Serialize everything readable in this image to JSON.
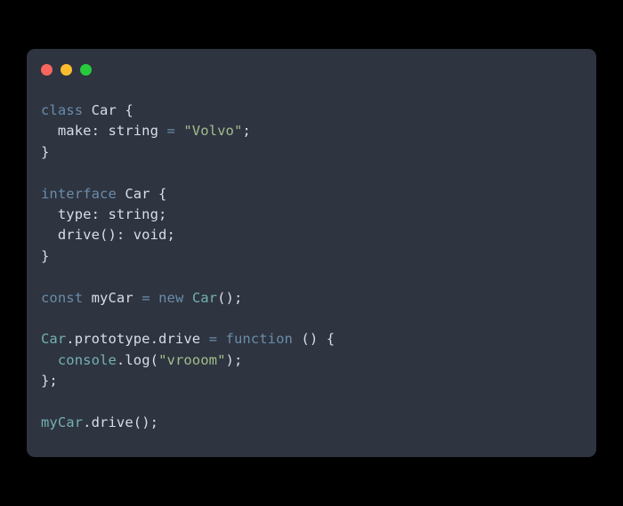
{
  "window": {
    "title": "code-snippet-card",
    "background_color": "#000000",
    "card_color": "#2e3440",
    "traffic_lights": [
      {
        "name": "close",
        "color": "#f9665e"
      },
      {
        "name": "minimize",
        "color": "#fbbd2e"
      },
      {
        "name": "maximize",
        "color": "#28c93f"
      }
    ]
  },
  "theme": {
    "keyword_color": "#6a8caa",
    "plain_color": "#d8dee9",
    "string_color": "#a3be8c",
    "type_color": "#74b1b2",
    "operator_color": "#6a8caa"
  },
  "code": {
    "language": "typescript",
    "plain_text": "class Car {\n  make: string = \"Volvo\";\n}\n\ninterface Car {\n  type: string;\n  drive(): void;\n}\n\nconst myCar = new Car();\n\nCar.prototype.drive = function () {\n  console.log(\"vrooom\");\n};\n\nmyCar.drive();",
    "lines": [
      {
        "n": 1,
        "tokens": [
          {
            "t": "class",
            "k": "keyword"
          },
          {
            "t": " Car {",
            "k": "plain"
          }
        ]
      },
      {
        "n": 2,
        "tokens": [
          {
            "t": "  make: string ",
            "k": "plain"
          },
          {
            "t": "=",
            "k": "operator"
          },
          {
            "t": " ",
            "k": "plain"
          },
          {
            "t": "\"Volvo\"",
            "k": "string"
          },
          {
            "t": ";",
            "k": "plain"
          }
        ]
      },
      {
        "n": 3,
        "tokens": [
          {
            "t": "}",
            "k": "plain"
          }
        ]
      },
      {
        "n": 4,
        "tokens": [
          {
            "t": " ",
            "k": "blank"
          }
        ]
      },
      {
        "n": 5,
        "tokens": [
          {
            "t": "interface",
            "k": "keyword"
          },
          {
            "t": " Car {",
            "k": "plain"
          }
        ]
      },
      {
        "n": 6,
        "tokens": [
          {
            "t": "  type: string;",
            "k": "plain"
          }
        ]
      },
      {
        "n": 7,
        "tokens": [
          {
            "t": "  drive(): void;",
            "k": "plain"
          }
        ]
      },
      {
        "n": 8,
        "tokens": [
          {
            "t": "}",
            "k": "plain"
          }
        ]
      },
      {
        "n": 9,
        "tokens": [
          {
            "t": " ",
            "k": "blank"
          }
        ]
      },
      {
        "n": 10,
        "tokens": [
          {
            "t": "const",
            "k": "keyword"
          },
          {
            "t": " myCar ",
            "k": "plain"
          },
          {
            "t": "=",
            "k": "operator"
          },
          {
            "t": " ",
            "k": "plain"
          },
          {
            "t": "new",
            "k": "keyword"
          },
          {
            "t": " ",
            "k": "plain"
          },
          {
            "t": "Car",
            "k": "type"
          },
          {
            "t": "();",
            "k": "plain"
          }
        ]
      },
      {
        "n": 11,
        "tokens": [
          {
            "t": " ",
            "k": "blank"
          }
        ]
      },
      {
        "n": 12,
        "tokens": [
          {
            "t": "Car",
            "k": "type"
          },
          {
            "t": ".prototype.drive ",
            "k": "plain"
          },
          {
            "t": "=",
            "k": "operator"
          },
          {
            "t": " ",
            "k": "plain"
          },
          {
            "t": "function",
            "k": "keyword"
          },
          {
            "t": " () {",
            "k": "plain"
          }
        ]
      },
      {
        "n": 13,
        "tokens": [
          {
            "t": "  ",
            "k": "plain"
          },
          {
            "t": "console",
            "k": "type"
          },
          {
            "t": ".log(",
            "k": "plain"
          },
          {
            "t": "\"vrooom\"",
            "k": "string"
          },
          {
            "t": ");",
            "k": "plain"
          }
        ]
      },
      {
        "n": 14,
        "tokens": [
          {
            "t": "};",
            "k": "plain"
          }
        ]
      },
      {
        "n": 15,
        "tokens": [
          {
            "t": " ",
            "k": "blank"
          }
        ]
      },
      {
        "n": 16,
        "tokens": [
          {
            "t": "myCar",
            "k": "type"
          },
          {
            "t": ".drive();",
            "k": "plain"
          }
        ]
      }
    ]
  }
}
